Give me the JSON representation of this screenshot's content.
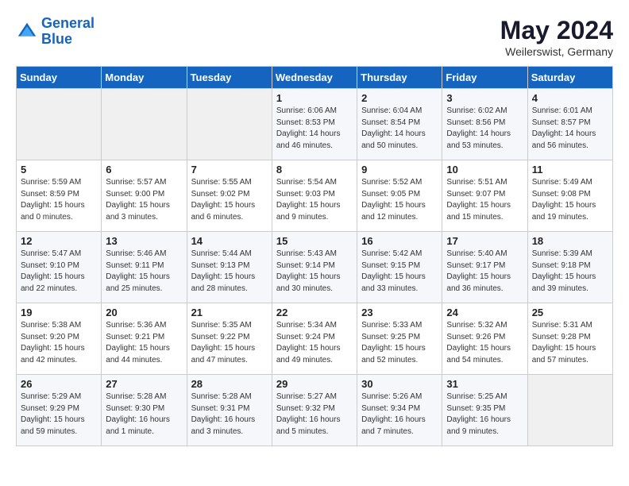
{
  "header": {
    "logo_line1": "General",
    "logo_line2": "Blue",
    "month": "May 2024",
    "location": "Weilerswist, Germany"
  },
  "weekdays": [
    "Sunday",
    "Monday",
    "Tuesday",
    "Wednesday",
    "Thursday",
    "Friday",
    "Saturday"
  ],
  "weeks": [
    [
      {
        "day": "",
        "empty": true
      },
      {
        "day": "",
        "empty": true
      },
      {
        "day": "",
        "empty": true
      },
      {
        "day": "1",
        "sunrise": "6:06 AM",
        "sunset": "8:53 PM",
        "daylight": "14 hours and 46 minutes."
      },
      {
        "day": "2",
        "sunrise": "6:04 AM",
        "sunset": "8:54 PM",
        "daylight": "14 hours and 50 minutes."
      },
      {
        "day": "3",
        "sunrise": "6:02 AM",
        "sunset": "8:56 PM",
        "daylight": "14 hours and 53 minutes."
      },
      {
        "day": "4",
        "sunrise": "6:01 AM",
        "sunset": "8:57 PM",
        "daylight": "14 hours and 56 minutes."
      }
    ],
    [
      {
        "day": "5",
        "sunrise": "5:59 AM",
        "sunset": "8:59 PM",
        "daylight": "15 hours and 0 minutes."
      },
      {
        "day": "6",
        "sunrise": "5:57 AM",
        "sunset": "9:00 PM",
        "daylight": "15 hours and 3 minutes."
      },
      {
        "day": "7",
        "sunrise": "5:55 AM",
        "sunset": "9:02 PM",
        "daylight": "15 hours and 6 minutes."
      },
      {
        "day": "8",
        "sunrise": "5:54 AM",
        "sunset": "9:03 PM",
        "daylight": "15 hours and 9 minutes."
      },
      {
        "day": "9",
        "sunrise": "5:52 AM",
        "sunset": "9:05 PM",
        "daylight": "15 hours and 12 minutes."
      },
      {
        "day": "10",
        "sunrise": "5:51 AM",
        "sunset": "9:07 PM",
        "daylight": "15 hours and 15 minutes."
      },
      {
        "day": "11",
        "sunrise": "5:49 AM",
        "sunset": "9:08 PM",
        "daylight": "15 hours and 19 minutes."
      }
    ],
    [
      {
        "day": "12",
        "sunrise": "5:47 AM",
        "sunset": "9:10 PM",
        "daylight": "15 hours and 22 minutes."
      },
      {
        "day": "13",
        "sunrise": "5:46 AM",
        "sunset": "9:11 PM",
        "daylight": "15 hours and 25 minutes."
      },
      {
        "day": "14",
        "sunrise": "5:44 AM",
        "sunset": "9:13 PM",
        "daylight": "15 hours and 28 minutes."
      },
      {
        "day": "15",
        "sunrise": "5:43 AM",
        "sunset": "9:14 PM",
        "daylight": "15 hours and 30 minutes."
      },
      {
        "day": "16",
        "sunrise": "5:42 AM",
        "sunset": "9:15 PM",
        "daylight": "15 hours and 33 minutes."
      },
      {
        "day": "17",
        "sunrise": "5:40 AM",
        "sunset": "9:17 PM",
        "daylight": "15 hours and 36 minutes."
      },
      {
        "day": "18",
        "sunrise": "5:39 AM",
        "sunset": "9:18 PM",
        "daylight": "15 hours and 39 minutes."
      }
    ],
    [
      {
        "day": "19",
        "sunrise": "5:38 AM",
        "sunset": "9:20 PM",
        "daylight": "15 hours and 42 minutes."
      },
      {
        "day": "20",
        "sunrise": "5:36 AM",
        "sunset": "9:21 PM",
        "daylight": "15 hours and 44 minutes."
      },
      {
        "day": "21",
        "sunrise": "5:35 AM",
        "sunset": "9:22 PM",
        "daylight": "15 hours and 47 minutes."
      },
      {
        "day": "22",
        "sunrise": "5:34 AM",
        "sunset": "9:24 PM",
        "daylight": "15 hours and 49 minutes."
      },
      {
        "day": "23",
        "sunrise": "5:33 AM",
        "sunset": "9:25 PM",
        "daylight": "15 hours and 52 minutes."
      },
      {
        "day": "24",
        "sunrise": "5:32 AM",
        "sunset": "9:26 PM",
        "daylight": "15 hours and 54 minutes."
      },
      {
        "day": "25",
        "sunrise": "5:31 AM",
        "sunset": "9:28 PM",
        "daylight": "15 hours and 57 minutes."
      }
    ],
    [
      {
        "day": "26",
        "sunrise": "5:29 AM",
        "sunset": "9:29 PM",
        "daylight": "15 hours and 59 minutes."
      },
      {
        "day": "27",
        "sunrise": "5:28 AM",
        "sunset": "9:30 PM",
        "daylight": "16 hours and 1 minute."
      },
      {
        "day": "28",
        "sunrise": "5:28 AM",
        "sunset": "9:31 PM",
        "daylight": "16 hours and 3 minutes."
      },
      {
        "day": "29",
        "sunrise": "5:27 AM",
        "sunset": "9:32 PM",
        "daylight": "16 hours and 5 minutes."
      },
      {
        "day": "30",
        "sunrise": "5:26 AM",
        "sunset": "9:34 PM",
        "daylight": "16 hours and 7 minutes."
      },
      {
        "day": "31",
        "sunrise": "5:25 AM",
        "sunset": "9:35 PM",
        "daylight": "16 hours and 9 minutes."
      },
      {
        "day": "",
        "empty": true
      }
    ]
  ]
}
